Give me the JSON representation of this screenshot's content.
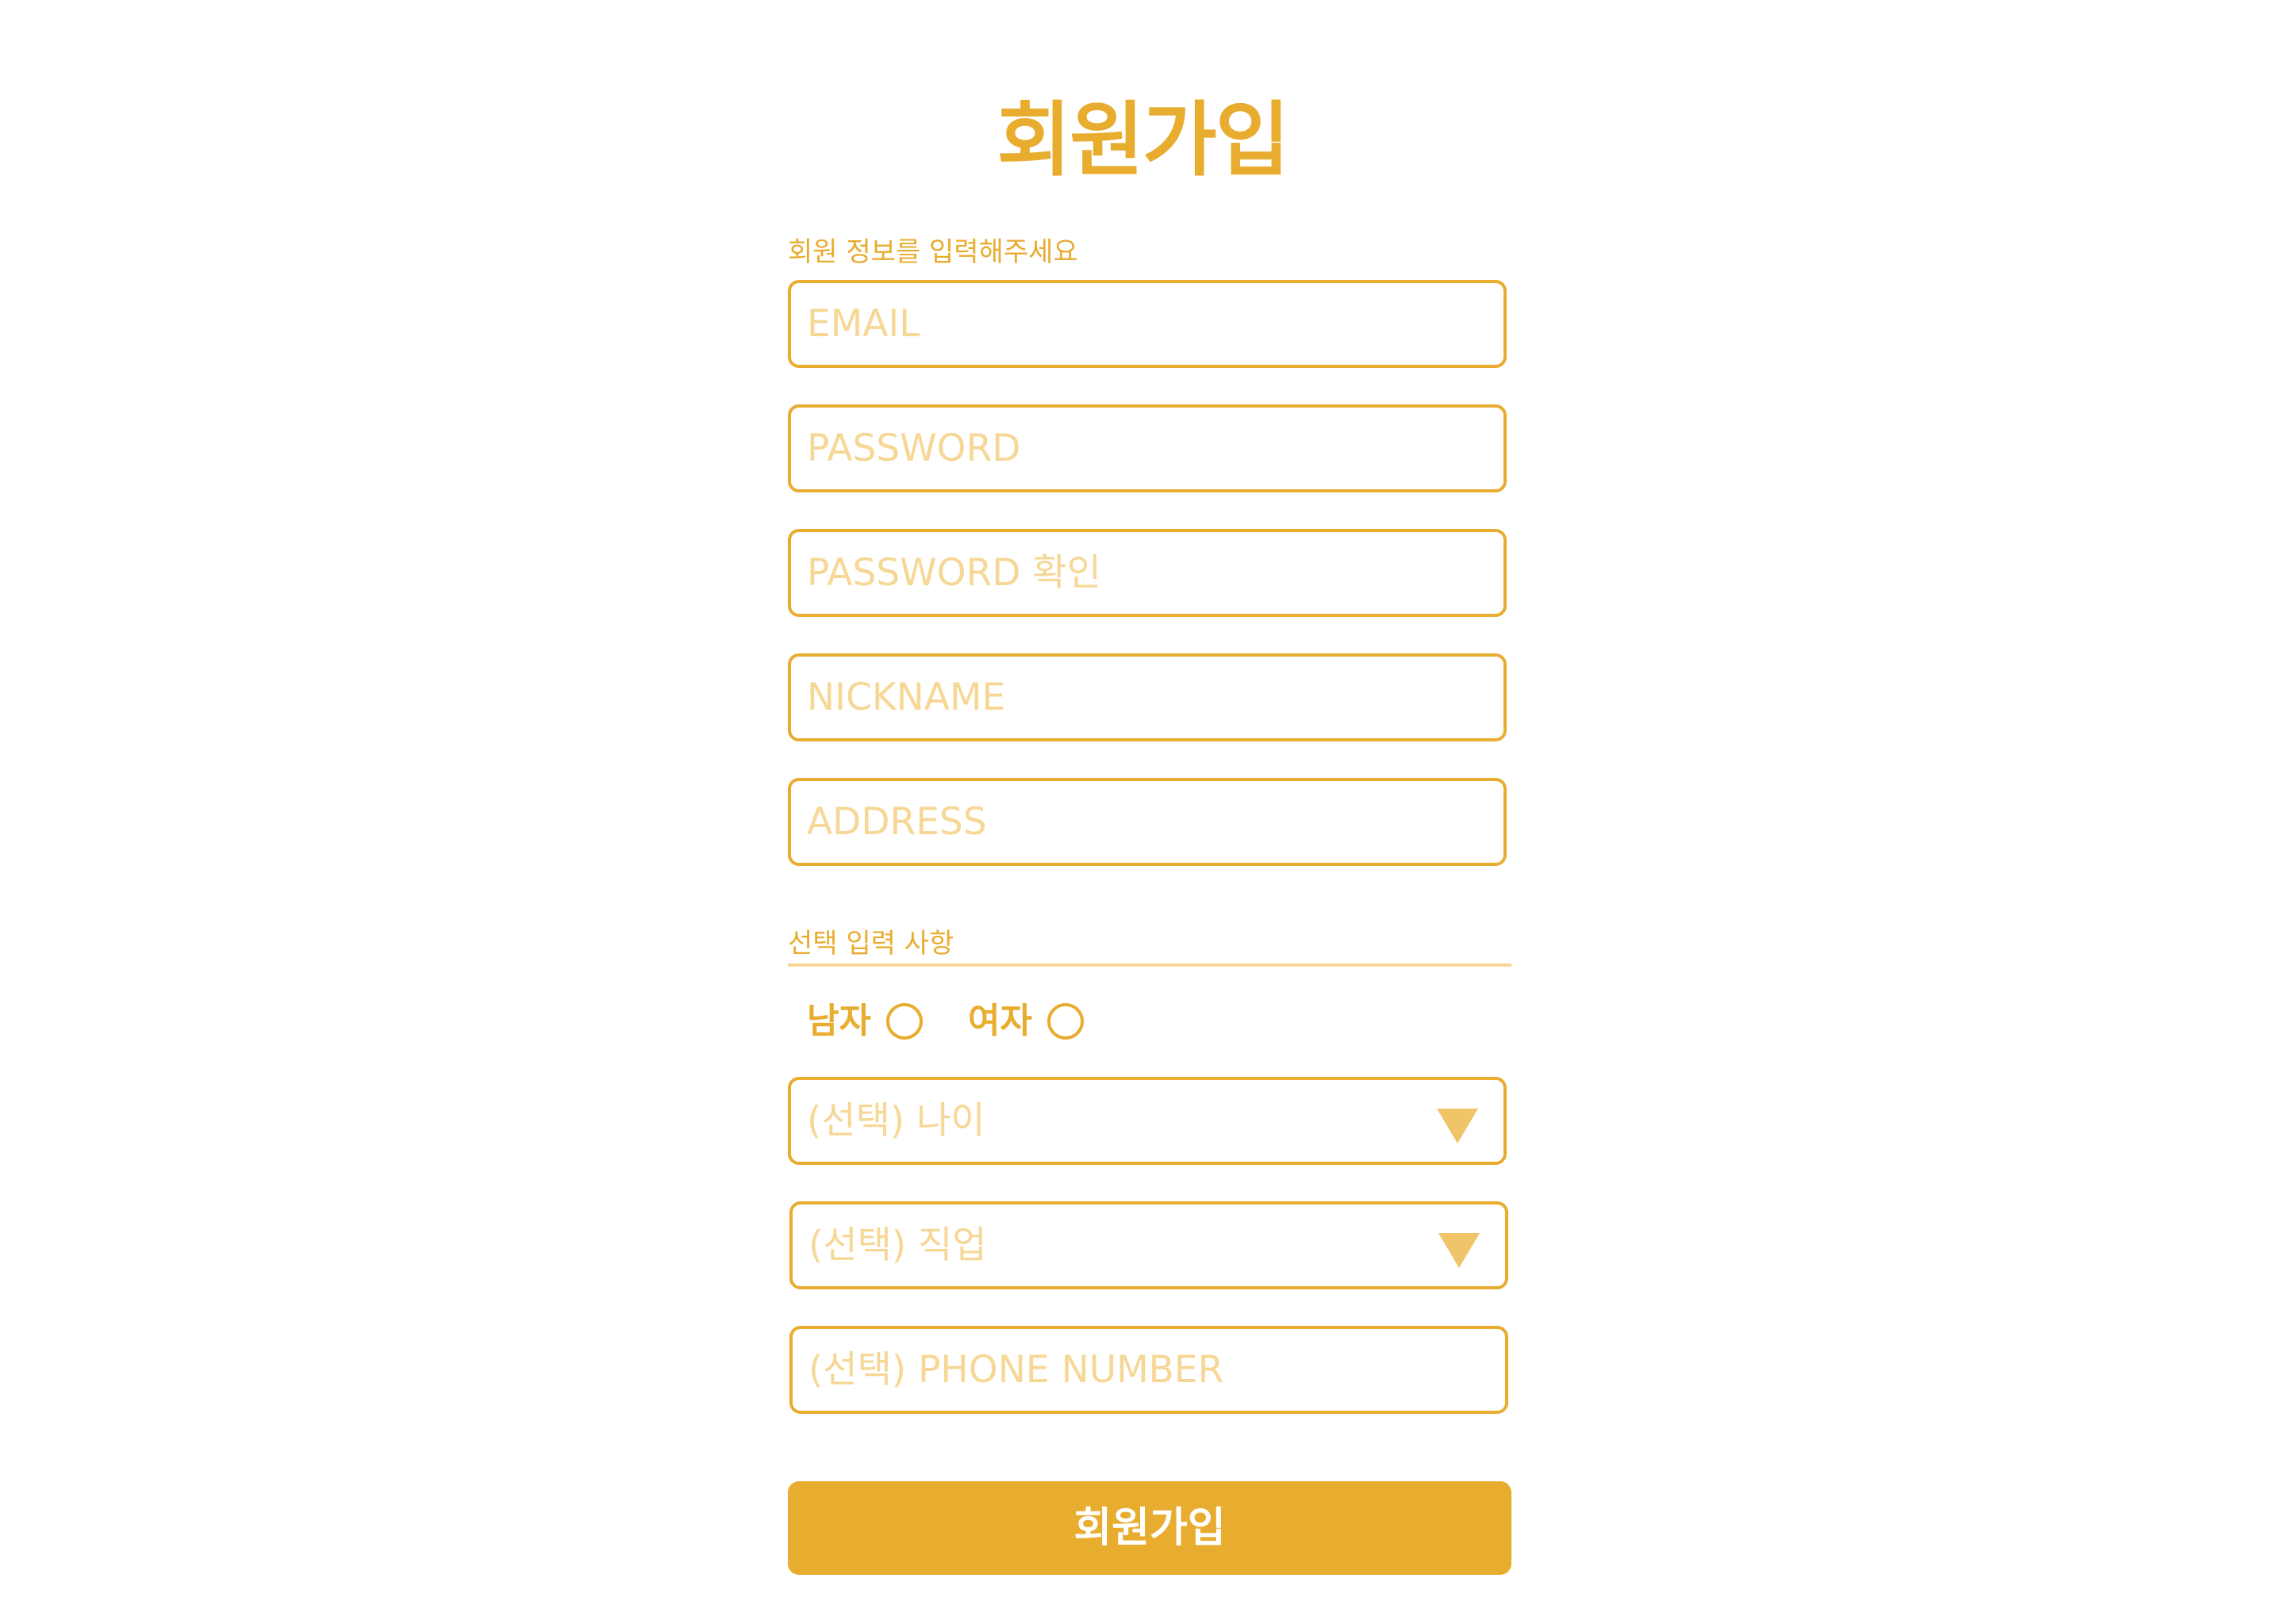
{
  "title": "회원가입",
  "required_section": {
    "label": "회원 정보를 입력해주세요",
    "fields": [
      {
        "placeholder": "EMAIL"
      },
      {
        "placeholder": "PASSWORD"
      },
      {
        "placeholder": "PASSWORD 확인"
      },
      {
        "placeholder": "NICKNAME"
      },
      {
        "placeholder": "ADDRESS"
      }
    ]
  },
  "optional_section": {
    "label": "선택 입력 사항",
    "gender": {
      "male": "남자",
      "female": "여자"
    },
    "age_select": {
      "placeholder": "(선택) 나이"
    },
    "job_select": {
      "placeholder": "(선택) 직업"
    },
    "phone": {
      "placeholder": "(선택) PHONE NUMBER"
    }
  },
  "submit_label": "회원가입",
  "colors": {
    "accent": "#E8AC2F",
    "placeholder": "#F6D795",
    "divider": "#F6D795",
    "dropdown_arrow": "#F0C468",
    "background": "#FFFFFF"
  }
}
